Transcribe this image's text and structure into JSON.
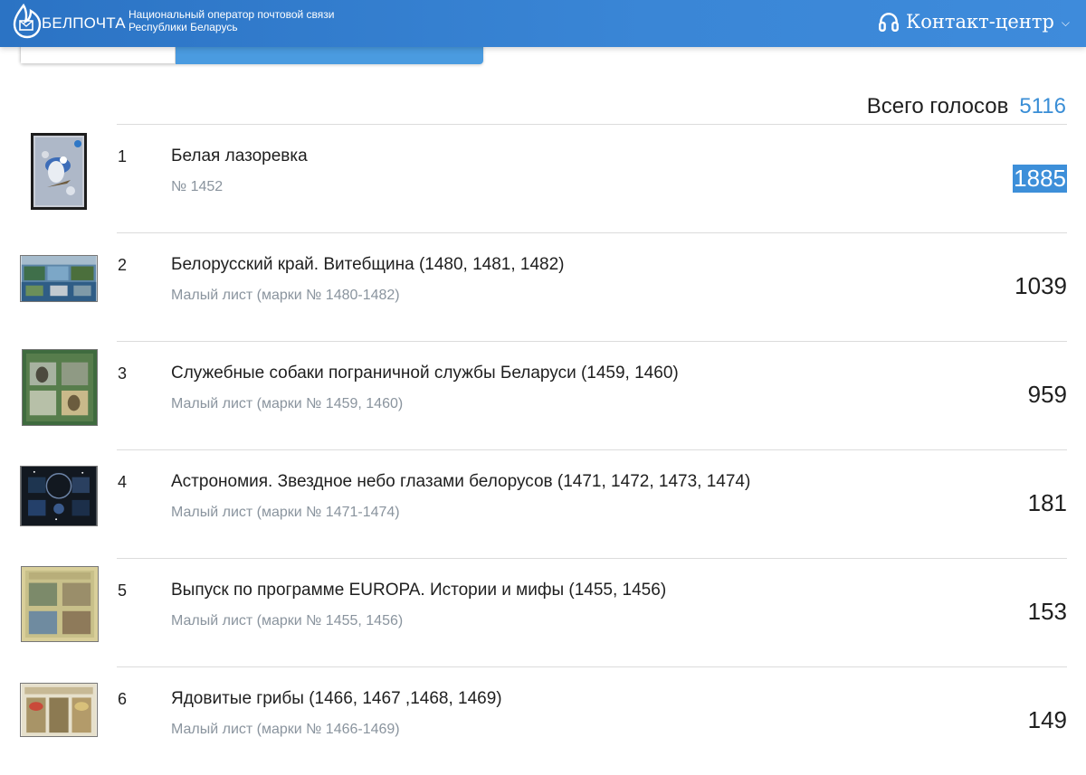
{
  "header": {
    "logo_text": "БЕЛПОЧТА",
    "operator_line1": "Национальный оператор почтовой связи",
    "operator_line2": "Республики Беларусь",
    "contact_label": "Контакт-центр",
    "colors": {
      "bar": "#3580d0",
      "accent": "#3a8ed6"
    }
  },
  "total": {
    "label": "Всего голосов",
    "value": "5116"
  },
  "items": [
    {
      "rank": "1",
      "title": "Белая лазоревка",
      "sub": "№ 1452",
      "votes": "1885",
      "selected": true
    },
    {
      "rank": "2",
      "title": "Белорусский край. Витебщина (1480, 1481, 1482)",
      "sub": "Малый лист (марки № 1480-1482)",
      "votes": "1039"
    },
    {
      "rank": "3",
      "title": "Служебные собаки пограничной службы Беларуси (1459, 1460)",
      "sub": "Малый лист (марки № 1459, 1460)",
      "votes": "959"
    },
    {
      "rank": "4",
      "title": "Астрономия. Звездное небо глазами белорусов (1471, 1472, 1473, 1474)",
      "sub": "Малый лист (марки № 1471-1474)",
      "votes": "181"
    },
    {
      "rank": "5",
      "title": "Выпуск по программе EUROPA. Истории и мифы (1455, 1456)",
      "sub": "Малый лист (марки № 1455, 1456)",
      "votes": "153"
    },
    {
      "rank": "6",
      "title": "Ядовитые грибы (1466, 1467 ,1468, 1469)",
      "sub": "Малый лист (марки № 1466-1469)",
      "votes": "149"
    }
  ]
}
